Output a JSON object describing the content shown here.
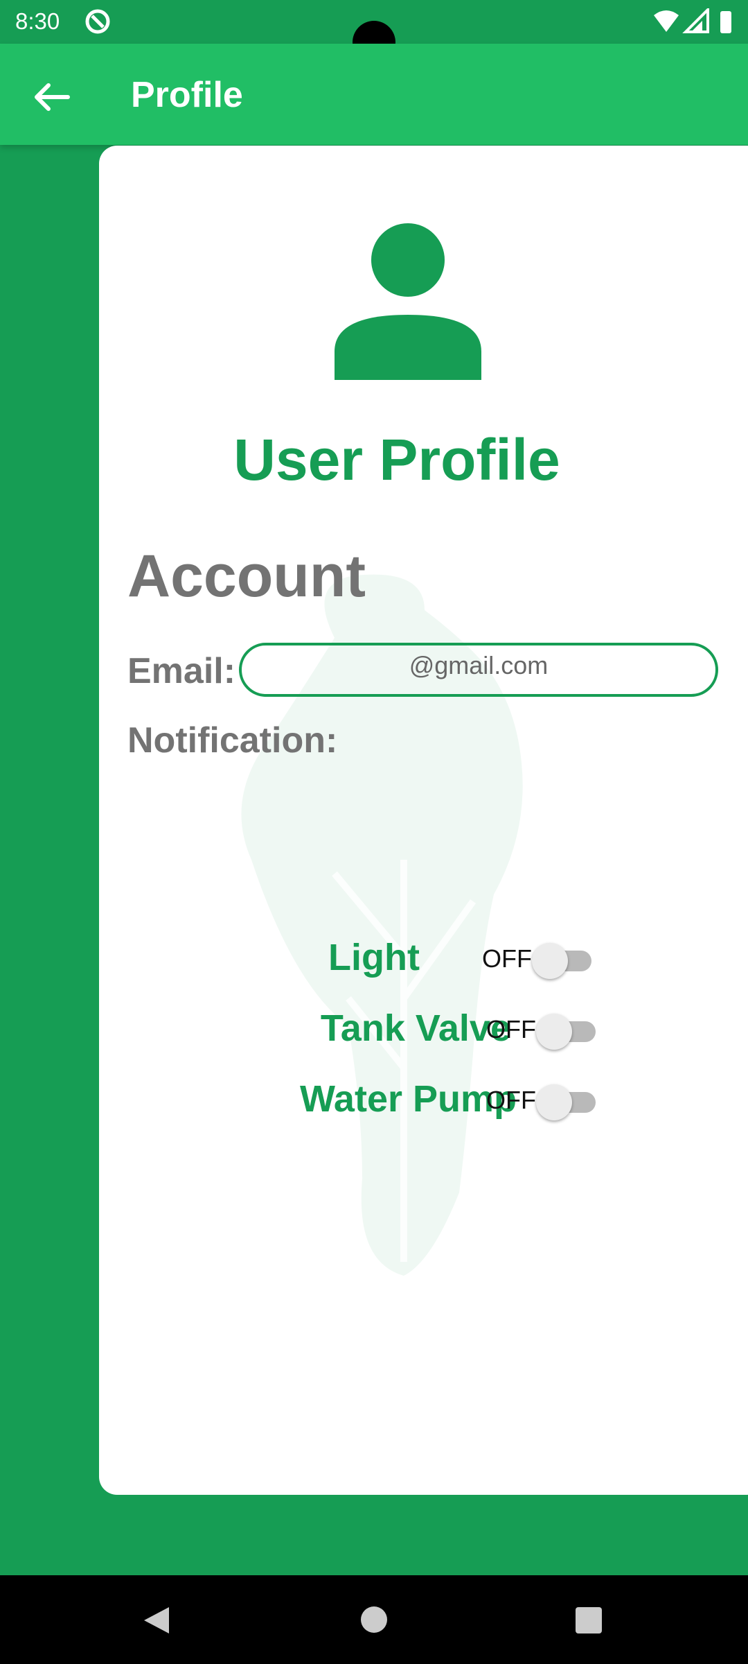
{
  "status_bar": {
    "time": "8:30"
  },
  "app_bar": {
    "title": "Profile"
  },
  "profile": {
    "heading": "User Profile"
  },
  "account": {
    "section_title": "Account",
    "email_label": "Email:",
    "email_value": "@gmail.com",
    "notification_label": "Notification:"
  },
  "notifications": [
    {
      "label": "Light",
      "state": "OFF",
      "enabled": false
    },
    {
      "label": "Tank Valve",
      "state": "OFF",
      "enabled": false
    },
    {
      "label": "Water Pump",
      "state": "OFF",
      "enabled": false
    }
  ],
  "colors": {
    "primary": "#21be65",
    "primary_dark": "#169d54",
    "label_grey": "#737373"
  },
  "icons": {
    "back": "arrow-left-icon",
    "avatar": "person-icon",
    "watermark": "plant-leaf-icon"
  }
}
